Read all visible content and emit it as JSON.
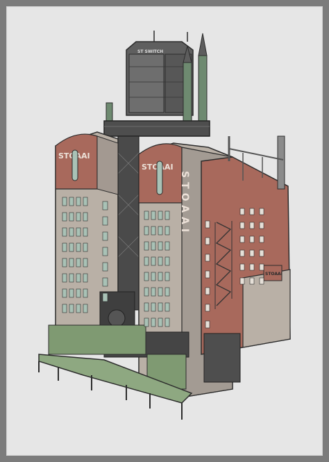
{
  "artwork": {
    "left_sign": "STOAAI",
    "right_sign": "STOAAI",
    "vertical_sign": "STOAAI",
    "tank_label": "ST SWITCH",
    "side_billboard": "STOAAI"
  },
  "colors": {
    "page_border": "#7c7c7c",
    "paper": "#e6e6e6",
    "brick": "#a8695c",
    "stone": "#b9b0a6",
    "steel": "#5c5c5c",
    "awning": "#7f9a72",
    "window_glass": "#a9c2b6"
  }
}
